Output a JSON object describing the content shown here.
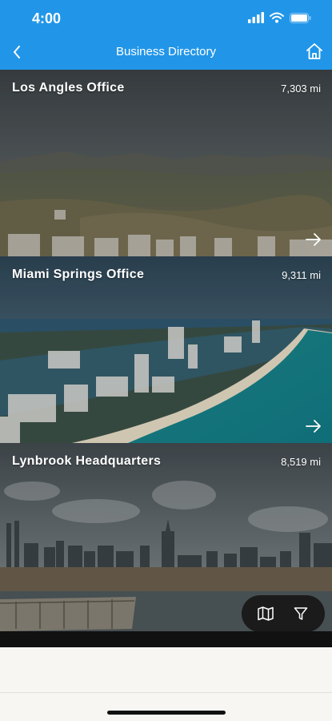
{
  "status_bar": {
    "time": "4:00"
  },
  "nav": {
    "title": "Business Directory"
  },
  "offices": [
    {
      "name": "Los Angles Office",
      "distance": "7,303 mi"
    },
    {
      "name": "Miami Springs Office",
      "distance": "9,311 mi"
    },
    {
      "name": "Lynbrook Headquarters",
      "distance": "8,519 mi"
    }
  ],
  "colors": {
    "accent": "#2196e8",
    "fab": "#1b1b1b"
  },
  "icons": [
    "back-chevron-icon",
    "home-icon",
    "arrow-right-icon",
    "map-icon",
    "filter-icon"
  ]
}
